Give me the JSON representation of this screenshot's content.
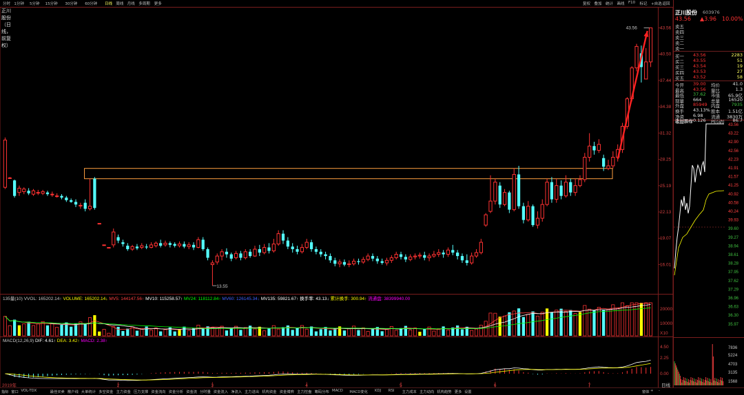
{
  "toolbar": {
    "periods": [
      "分时",
      "1分钟",
      "5分钟",
      "15分钟",
      "30分钟",
      "60分钟",
      "日线",
      "周线",
      "月线",
      "多周期",
      "更多"
    ],
    "right_items": [
      "复权",
      "叠加",
      "统计",
      "画线",
      "F10",
      "标记",
      "+自选",
      "返回"
    ]
  },
  "title": "正川股份（日线，前复权）",
  "stock": {
    "name": "正川股份",
    "code": "603976",
    "price": "43.56",
    "change": "▲3.96",
    "pct": "10.00%"
  },
  "colors": {
    "up": "#ff3232",
    "down": "#54ffff",
    "ma5": "#ffffff",
    "ma10": "#ffff00",
    "ma20": "#ff00ff",
    "ma60": "#00ff00",
    "box": "#ffa040",
    "arrow": "#ff2222",
    "bg": "#000000",
    "grid": "#7a1d1d"
  },
  "price_axis": [
    "43.56",
    "40.50",
    "37.44",
    "34.38",
    "31.32",
    "28.25",
    "25.19",
    "22.13",
    "19.07",
    "16.01"
  ],
  "annotations": {
    "high_label": "43.56",
    "low_label": "13.55",
    "start_label": "2019年",
    "date_ticks": [
      "2",
      "3",
      "4",
      "5",
      "6",
      "7"
    ]
  },
  "volume_legend": {
    "prefix": "135量(10)",
    "items": [
      {
        "label": "VVOL: 165202.14↑",
        "color": "#c8c8c8"
      },
      {
        "label": "VOLUME: 165202.14↓",
        "color": "#ffff00"
      },
      {
        "label": "MV5: 144147.56↑",
        "color": "#ff4040"
      },
      {
        "label": "MV10: 115258.57↑",
        "color": "#ffffff"
      },
      {
        "label": "MV24: 118112.84↑",
        "color": "#00ff00"
      },
      {
        "label": "MV60: 126145.34↓",
        "color": "#4060ff"
      },
      {
        "label": "MV135: 59821.67↑",
        "color": "#ffffff"
      },
      {
        "label": "换手率: 43.13↓",
        "color": "#ffffff"
      },
      {
        "label": "累计换手: 300.94↑",
        "color": "#ffff00"
      },
      {
        "label": "流通盘: 38399940.00",
        "color": "#ff00ff"
      }
    ],
    "axis": [
      "20000",
      "10000",
      "X10"
    ]
  },
  "macd_legend": {
    "items": [
      {
        "label": "MACD(12,26,9)",
        "color": "#c8c8c8"
      },
      {
        "label": "DIF: 4.61↑",
        "color": "#ffffff"
      },
      {
        "label": "DEA: 3.42↑",
        "color": "#ffff00"
      },
      {
        "label": "MACD: 2.38↑",
        "color": "#ff00ff"
      }
    ],
    "axis": [
      "4.50",
      "2.25",
      "0.00"
    ]
  },
  "order_book": {
    "sell": [
      [
        "卖五",
        ""
      ],
      [
        "卖四",
        ""
      ],
      [
        "卖三",
        ""
      ],
      [
        "卖二",
        ""
      ],
      [
        "卖一",
        ""
      ]
    ],
    "buy": [
      [
        "买一",
        "43.56",
        "2283"
      ],
      [
        "买二",
        "43.55",
        "51"
      ],
      [
        "买三",
        "43.54",
        "19"
      ],
      [
        "买四",
        "43.53",
        "27"
      ],
      [
        "买五",
        "43.52",
        "58"
      ]
    ]
  },
  "stats": [
    [
      "今开",
      "39.00",
      "均价",
      "41.0"
    ],
    [
      "最高",
      "43.56",
      "量比",
      "1.3"
    ],
    [
      "最低",
      "37.62",
      "市值",
      "65.9亿"
    ],
    [
      "现量",
      "664",
      "总量",
      "16520"
    ],
    [
      "外盘",
      "85949",
      "内盘",
      "7935"
    ],
    [
      "换手",
      "43.13%",
      "股本",
      "1.51亿"
    ],
    [
      "净资",
      "6.98",
      "流通",
      "3830万"
    ],
    [
      "收益(一)",
      "0.126",
      "PE(动)",
      "86.7"
    ]
  ],
  "intraday": {
    "title": "正川股份",
    "axis_right": [
      "43.56",
      "43.22",
      "42.90",
      "42.56",
      "42.23",
      "41.91",
      "41.57",
      "41.25",
      "40.92",
      "40.58",
      "40.24",
      "39.93",
      "39.60",
      "39.27",
      "38.94",
      "38.61",
      "38.28",
      "37.95",
      "37.62",
      "37.29",
      "36.96",
      "36.63",
      "36.30",
      "35.97"
    ],
    "vol_axis": [
      "7836",
      "5224",
      "4703",
      "3135",
      "1568"
    ],
    "footer": "日线"
  },
  "bottom_tabs": [
    "指标",
    "窗口",
    "VOL-TDX",
    "最佳买卖",
    "散户线",
    "大单统计",
    "多空资金",
    "主力资金",
    "压力支撑",
    "资金流向",
    "资金分析",
    "资金流",
    "分时量",
    "资金流入",
    "净流入",
    "主力进出",
    "机构资金",
    "资金博弈",
    "主力控盘",
    "筹码分布",
    "MACD",
    "MACD变化",
    "KDJ",
    "RSI",
    "主力成本",
    "主力动向",
    "机构趋势",
    "更多",
    "设置"
  ],
  "bottom_right": [
    "窗体",
    "+",
    "-"
  ],
  "chart_data": {
    "type": "candlestick",
    "candles": [
      [
        25.0,
        30.5,
        30.8,
        24.8
      ],
      [
        26.1,
        26.1,
        26.2,
        26.0
      ],
      [
        25.8,
        24.0,
        25.9,
        23.8
      ],
      [
        24.4,
        24.9,
        25.2,
        24.0
      ],
      [
        24.5,
        24.8,
        25.0,
        24.2
      ],
      [
        24.6,
        24.3,
        24.9,
        24.1
      ],
      [
        24.2,
        24.6,
        24.8,
        24.0
      ],
      [
        24.4,
        24.4,
        24.7,
        24.1
      ],
      [
        24.3,
        24.5,
        24.7,
        24.1
      ],
      [
        24.4,
        24.2,
        24.6,
        24.0
      ],
      [
        24.2,
        24.2,
        24.5,
        23.9
      ],
      [
        24.0,
        24.0,
        24.3,
        23.8
      ],
      [
        24.0,
        23.8,
        24.2,
        23.6
      ],
      [
        23.8,
        23.5,
        24.0,
        23.3
      ],
      [
        23.5,
        23.3,
        23.7,
        23.2
      ],
      [
        23.3,
        23.0,
        23.6,
        22.7
      ],
      [
        22.9,
        22.9,
        23.2,
        22.5
      ],
      [
        23.2,
        22.5,
        23.6,
        22.2
      ],
      [
        22.5,
        22.8,
        26.0,
        22.3
      ],
      [
        26.0,
        22.6,
        26.2,
        22.4
      ],
      [
        20.8,
        20.8,
        20.8,
        20.8
      ],
      [
        18.3,
        18.3,
        18.3,
        18.3
      ],
      [
        18.0,
        18.0,
        18.0,
        18.0
      ],
      [
        18.3,
        19.8,
        20.2,
        18.0
      ],
      [
        19.2,
        18.8,
        19.5,
        18.5
      ],
      [
        18.6,
        18.4,
        18.9,
        18.1
      ],
      [
        18.2,
        17.8,
        18.5,
        17.6
      ],
      [
        17.8,
        18.1,
        18.3,
        17.6
      ],
      [
        18.1,
        17.9,
        18.4,
        17.7
      ],
      [
        18.0,
        18.2,
        18.5,
        17.8
      ],
      [
        18.1,
        18.0,
        18.4,
        17.8
      ],
      [
        18.0,
        18.3,
        18.6,
        17.9
      ],
      [
        18.2,
        18.5,
        18.7,
        18.0
      ],
      [
        18.5,
        18.2,
        18.9,
        18.0
      ],
      [
        18.3,
        18.5,
        18.8,
        18.1
      ],
      [
        18.5,
        18.3,
        18.7,
        18.0
      ],
      [
        18.4,
        18.2,
        18.6,
        18.0
      ],
      [
        18.2,
        18.4,
        18.7,
        18.0
      ],
      [
        18.4,
        18.1,
        18.7,
        17.9
      ],
      [
        18.1,
        18.3,
        18.6,
        17.8
      ],
      [
        18.3,
        18.0,
        18.6,
        17.7
      ],
      [
        18.0,
        18.9,
        19.2,
        17.9
      ],
      [
        18.9,
        17.8,
        19.2,
        17.6
      ],
      [
        17.8,
        16.8,
        18.0,
        16.5
      ],
      [
        16.0,
        16.2,
        16.5,
        13.55
      ],
      [
        16.3,
        17.0,
        17.3,
        16.0
      ],
      [
        17.0,
        17.5,
        17.8,
        16.5
      ],
      [
        17.5,
        17.2,
        17.9,
        16.8
      ],
      [
        17.2,
        16.7,
        17.4,
        16.4
      ],
      [
        16.8,
        17.3,
        17.6,
        16.6
      ],
      [
        17.3,
        16.8,
        17.6,
        16.5
      ],
      [
        16.8,
        17.5,
        17.8,
        16.6
      ],
      [
        17.5,
        17.0,
        17.8,
        16.8
      ],
      [
        17.0,
        17.8,
        18.2,
        16.9
      ],
      [
        17.8,
        17.4,
        18.3,
        17.0
      ],
      [
        17.4,
        18.0,
        18.4,
        17.2
      ],
      [
        18.0,
        17.6,
        18.5,
        17.3
      ],
      [
        17.6,
        18.4,
        19.0,
        17.4
      ],
      [
        18.4,
        19.6,
        20.0,
        18.2
      ],
      [
        19.6,
        18.8,
        20.0,
        18.4
      ],
      [
        18.8,
        18.1,
        19.2,
        17.8
      ],
      [
        18.1,
        17.8,
        18.5,
        17.4
      ],
      [
        17.8,
        17.5,
        18.2,
        17.2
      ],
      [
        17.5,
        18.0,
        18.4,
        17.3
      ],
      [
        18.0,
        18.6,
        19.0,
        17.8
      ],
      [
        18.6,
        17.8,
        18.9,
        17.5
      ],
      [
        17.8,
        17.5,
        18.1,
        17.2
      ],
      [
        17.5,
        17.2,
        17.8,
        16.9
      ],
      [
        17.2,
        17.0,
        17.5,
        16.6
      ],
      [
        17.0,
        16.5,
        17.3,
        16.2
      ],
      [
        16.5,
        16.1,
        16.8,
        15.8
      ],
      [
        16.1,
        16.3,
        16.6,
        15.7
      ],
      [
        16.3,
        16.0,
        16.6,
        15.8
      ],
      [
        16.0,
        16.1,
        16.5,
        15.7
      ],
      [
        16.1,
        16.4,
        16.7,
        15.9
      ],
      [
        16.4,
        16.3,
        16.7,
        16.0
      ],
      [
        16.3,
        16.6,
        16.9,
        16.1
      ],
      [
        16.6,
        17.0,
        17.3,
        16.4
      ],
      [
        17.0,
        16.7,
        17.3,
        16.4
      ],
      [
        16.7,
        16.4,
        17.0,
        16.1
      ],
      [
        16.4,
        16.2,
        16.7,
        16.0
      ],
      [
        16.2,
        16.5,
        16.8,
        15.9
      ],
      [
        16.5,
        16.8,
        17.1,
        16.2
      ],
      [
        16.8,
        17.2,
        17.5,
        16.6
      ],
      [
        17.2,
        16.9,
        17.5,
        16.6
      ],
      [
        16.9,
        16.6,
        17.2,
        16.3
      ],
      [
        16.6,
        16.9,
        17.2,
        16.4
      ],
      [
        16.9,
        17.0,
        17.3,
        16.6
      ],
      [
        17.0,
        17.1,
        17.4,
        16.7
      ],
      [
        17.1,
        16.8,
        17.5,
        16.5
      ],
      [
        16.8,
        17.0,
        17.3,
        16.4
      ],
      [
        17.0,
        17.2,
        17.6,
        16.8
      ],
      [
        17.2,
        17.4,
        17.8,
        16.9
      ],
      [
        17.4,
        17.2,
        17.7,
        16.8
      ],
      [
        17.2,
        17.7,
        18.0,
        16.9
      ],
      [
        17.7,
        17.4,
        18.3,
        17.1
      ],
      [
        17.4,
        17.0,
        17.7,
        16.6
      ],
      [
        17.0,
        16.5,
        17.3,
        16.2
      ],
      [
        16.5,
        16.2,
        17.2,
        15.9
      ],
      [
        16.2,
        17.0,
        17.4,
        16.0
      ],
      [
        17.0,
        17.4,
        17.8,
        16.8
      ],
      [
        17.4,
        18.6,
        19.0,
        17.2
      ],
      [
        20.6,
        21.8,
        22.0,
        20.4
      ],
      [
        22.2,
        23.4,
        26.4,
        22.0
      ],
      [
        23.4,
        25.6,
        26.0,
        23.0
      ],
      [
        25.2,
        23.0,
        25.6,
        22.6
      ],
      [
        23.0,
        24.4,
        24.8,
        22.8
      ],
      [
        24.4,
        22.4,
        24.6,
        22.0
      ],
      [
        22.4,
        26.5,
        27.2,
        22.2
      ],
      [
        26.5,
        22.8,
        27.5,
        22.5
      ],
      [
        22.8,
        21.2,
        23.2,
        20.8
      ],
      [
        21.2,
        22.8,
        23.4,
        21.0
      ],
      [
        22.8,
        20.6,
        23.0,
        20.4
      ],
      [
        20.6,
        21.4,
        22.2,
        20.2
      ],
      [
        21.4,
        23.0,
        23.6,
        21.0
      ],
      [
        23.0,
        25.6,
        26.0,
        22.8
      ],
      [
        25.6,
        23.6,
        26.2,
        23.2
      ],
      [
        23.6,
        25.2,
        26.0,
        23.2
      ],
      [
        25.2,
        24.0,
        25.8,
        23.6
      ],
      [
        24.0,
        25.6,
        26.4,
        23.8
      ],
      [
        25.6,
        24.4,
        26.0,
        24.0
      ],
      [
        24.4,
        25.2,
        26.0,
        24.0
      ],
      [
        25.2,
        25.9,
        26.4,
        25.0
      ],
      [
        25.9,
        28.5,
        29.0,
        25.6
      ],
      [
        28.5,
        29.8,
        31.3,
        28.0
      ],
      [
        29.8,
        29.3,
        30.3,
        28.8
      ],
      [
        29.3,
        30.0,
        30.6,
        29.0
      ],
      [
        28.4,
        27.4,
        28.8,
        26.9
      ],
      [
        27.2,
        27.5,
        28.2,
        27.0
      ],
      [
        27.5,
        28.5,
        29.2,
        27.2
      ],
      [
        28.5,
        29.4,
        30.0,
        28.0
      ],
      [
        29.4,
        32.1,
        32.5,
        29.0
      ],
      [
        32.1,
        35.3,
        35.5,
        31.8
      ],
      [
        35.3,
        38.9,
        39.1,
        35.0
      ],
      [
        38.9,
        41.4,
        41.7,
        38.5
      ],
      [
        40.6,
        39.0,
        41.5,
        37.2
      ],
      [
        37.6,
        39.6,
        41.2,
        37.6
      ],
      [
        39.6,
        43.56,
        43.56,
        39.0
      ]
    ],
    "box": {
      "top": 27.2,
      "bottom": 26.0
    },
    "ylim": [
      13.0,
      45.2
    ]
  }
}
